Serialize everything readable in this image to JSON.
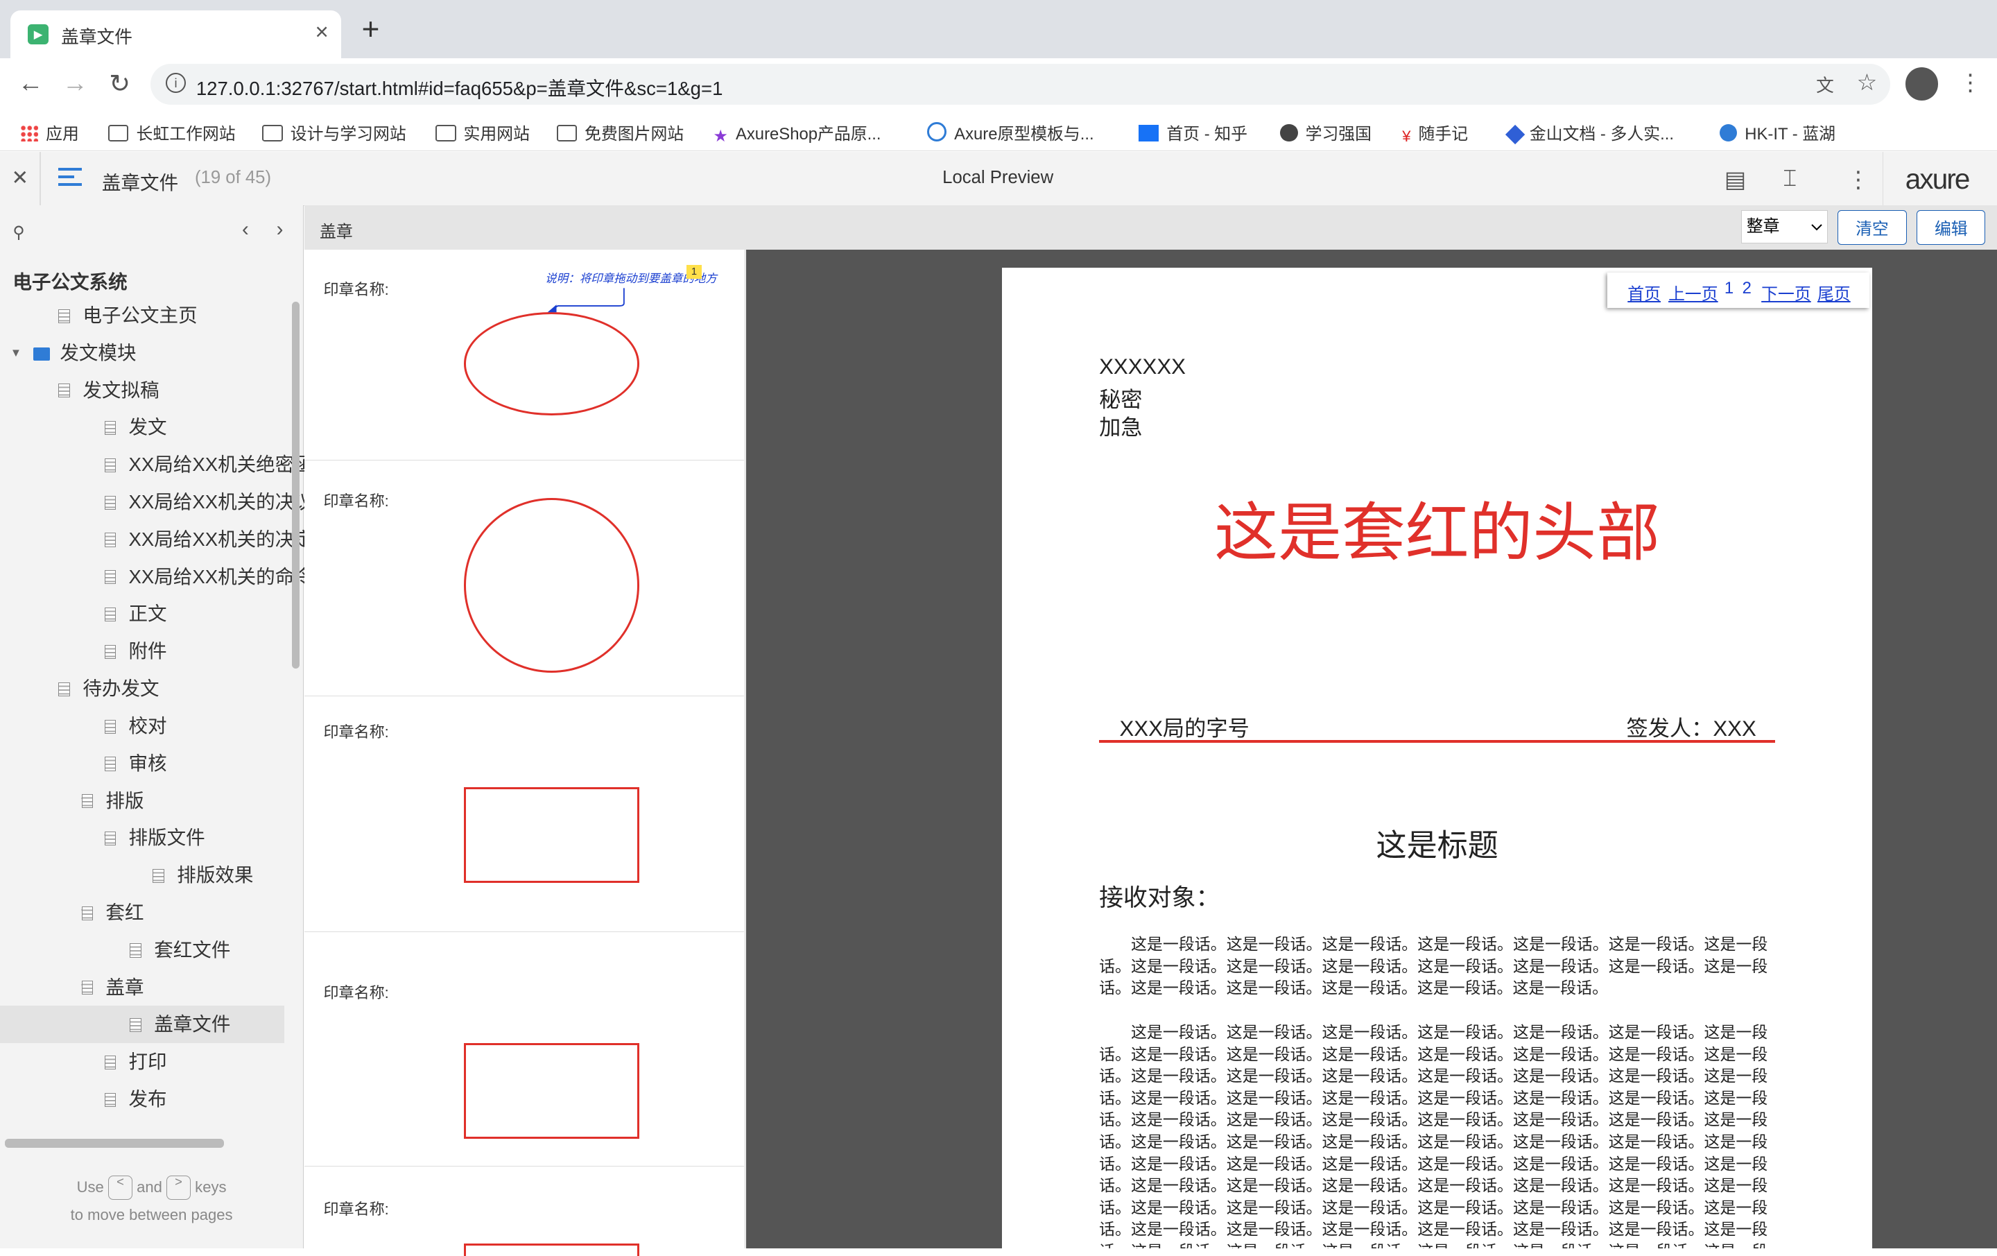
{
  "browser": {
    "tab_title": "盖章文件",
    "url": "127.0.0.1:32767/start.html#id=faq655&p=盖章文件&sc=1&g=1",
    "bookmarks": [
      "应用",
      "长虹工作网站",
      "设计与学习网站",
      "实用网站",
      "免费图片网站",
      "AxureShop产品原...",
      "Axure原型模板与...",
      "首页 - 知乎",
      "学习强国",
      "随手记",
      "金山文档 - 多人实...",
      "HK-IT - 蓝湖"
    ]
  },
  "axure": {
    "page_name": "盖章文件",
    "page_count": "(19 of 45)",
    "mode": "Local Preview",
    "logo": "axure"
  },
  "sidebar": {
    "root": "电子公文系统",
    "items": [
      {
        "label": "电子公文主页",
        "level": 1,
        "type": "page",
        "expanded": false
      },
      {
        "label": "发文模块",
        "level": 0,
        "type": "folder",
        "expanded": true
      },
      {
        "label": "发文拟稿",
        "level": 1,
        "type": "page",
        "expanded": true
      },
      {
        "label": "发文",
        "level": 3,
        "type": "page"
      },
      {
        "label": "XX局给XX机关绝密函",
        "level": 3,
        "type": "page"
      },
      {
        "label": "XX局给XX机关的决议",
        "level": 3,
        "type": "page"
      },
      {
        "label": "XX局给XX机关的决定",
        "level": 3,
        "type": "page"
      },
      {
        "label": "XX局给XX机关的命令",
        "level": 3,
        "type": "page"
      },
      {
        "label": "正文",
        "level": 3,
        "type": "page"
      },
      {
        "label": "附件",
        "level": 3,
        "type": "page"
      },
      {
        "label": "待办发文",
        "level": 1,
        "type": "page",
        "expanded": true
      },
      {
        "label": "校对",
        "level": 3,
        "type": "page"
      },
      {
        "label": "审核",
        "level": 3,
        "type": "page"
      },
      {
        "label": "排版",
        "level": 2,
        "type": "page",
        "expanded": true
      },
      {
        "label": "排版文件",
        "level": 3,
        "type": "page",
        "expanded": true,
        "tri": true
      },
      {
        "label": "排版效果",
        "level": 5,
        "type": "page"
      },
      {
        "label": "套红",
        "level": 2,
        "type": "page",
        "expanded": true
      },
      {
        "label": "套红文件",
        "level": 4,
        "type": "page"
      },
      {
        "label": "盖章",
        "level": 2,
        "type": "page",
        "expanded": true
      },
      {
        "label": "盖章文件",
        "level": 4,
        "type": "page",
        "selected": true
      },
      {
        "label": "打印",
        "level": 3,
        "type": "page"
      },
      {
        "label": "发布",
        "level": 3,
        "type": "page"
      }
    ],
    "hint_use": "Use",
    "hint_and": "and",
    "hint_keys": "keys",
    "hint_line2": "to move between pages",
    "key_prev": "<",
    "key_next": ">"
  },
  "content_header": {
    "label": "盖章",
    "select_value": "整章",
    "clear_label": "清空",
    "edit_label": "编辑"
  },
  "seals": {
    "label": "印章名称:",
    "note": "说明：将印章拖动到要盖章的地方",
    "note_badge": "1"
  },
  "pager": {
    "first": "首页",
    "prev": "上一页",
    "p1": "1",
    "p2": "2",
    "next": "下一页",
    "last": "尾页"
  },
  "document": {
    "code": "XXXXXX",
    "secret": "秘密",
    "urgent": "加急",
    "red_header": "这是套红的头部",
    "doc_number": "XXX局的字号",
    "signer": "签发人：XXX",
    "title": "这是标题",
    "recipient": "接收对象：",
    "para1": "这是一段话。这是一段话。这是一段话。这是一段话。这是一段话。这是一段话。这是一段话。这是一段话。这是一段话。这是一段话。这是一段话。这是一段话。这是一段话。这是一段话。这是一段话。这是一段话。这是一段话。这是一段话。这是一段话。",
    "para2": "这是一段话。这是一段话。这是一段话。这是一段话。这是一段话。这是一段话。这是一段话。这是一段话。这是一段话。这是一段话。这是一段话。这是一段话。这是一段话。这是一段话。这是一段话。这是一段话。这是一段话。这是一段话。这是一段话。这是一段话。这是一段话。这是一段话。这是一段话。这是一段话。这是一段话。这是一段话。这是一段话。这是一段话。这是一段话。这是一段话。这是一段话。这是一段话。这是一段话。这是一段话。这是一段话。这是一段话。这是一段话。这是一段话。这是一段话。这是一段话。这是一段话。这是一段话。这是一段话。这是一段话。这是一段话。这是一段话。这是一段话。这是一段话。这是一段话。这是一段话。这是一段话。这是一段话。这是一段话。这是一段话。这是一段话。这是一段话。这是一段话。这是一段话。这是一段话。这是一段话。这是一段话。这是一段话。这是一段话。这是一段话。这是一段话。这是一段话。这是一段话。这是一段话。这是一段话。这是一段话。这是一段话。这是一段话。这是一段话。这是一段话。这是一段话。这是一段话。这是一段话。这是一段话。这是一段话。这是一段话。这是一段话。这是一段话。这是一段话。这是一段话。这是一段话。这是一段话。这是一段话。"
  },
  "colors": {
    "accent": "#2f7cd6",
    "seal_red": "#e0302a",
    "link": "#1a3fd0"
  }
}
